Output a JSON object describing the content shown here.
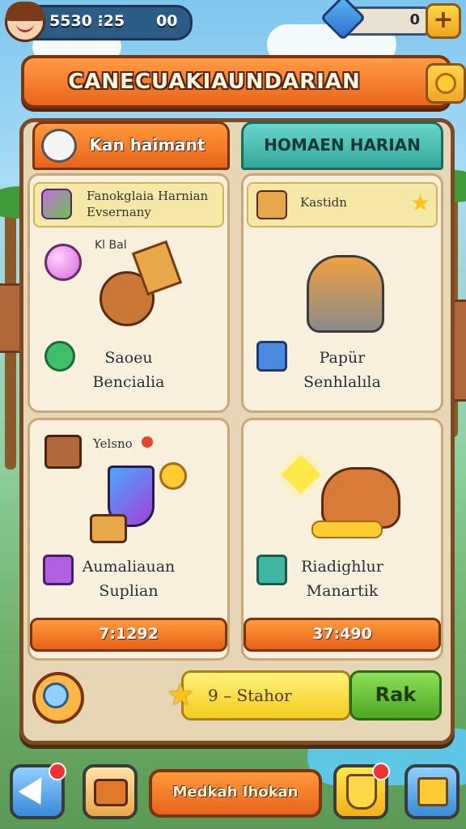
{
  "top_bar": {
    "stat_text": "5530 ⁝25",
    "stat_extra": "00",
    "gem_count": "0",
    "plus_label": "+"
  },
  "banner": {
    "title": "CANECUAKIAUNDARIAN"
  },
  "tabs": [
    {
      "label": "Kan haimant"
    },
    {
      "label": "HOMAEN HARIAN"
    }
  ],
  "cards": [
    {
      "subtitle_line1": "Fanokglaia Harnian",
      "subtitle_line2": "Evsernany",
      "tag": "Kl Bal",
      "name_line1": "Saoeu",
      "name_line2": "Bencialia"
    },
    {
      "subtitle_line1": "Kastidn",
      "name_line1": "Papür",
      "name_line2": "Senhlalıla"
    },
    {
      "tag": "Yelsno",
      "name_line1": "Aumaliauan",
      "name_line2": "Suplian",
      "timer": "7:1292"
    },
    {
      "name_line1": "Riadighlur",
      "name_line2": "Manartik",
      "timer": "37:490"
    }
  ],
  "bottom": {
    "yellow_text": "9 – Stahor",
    "green_label": "Rak"
  },
  "nav": {
    "center_label": "Medkah Ihokan"
  },
  "colors": {
    "accent_orange": "#e8631a",
    "accent_teal": "#33a79b",
    "board": "#e6d6b6"
  }
}
